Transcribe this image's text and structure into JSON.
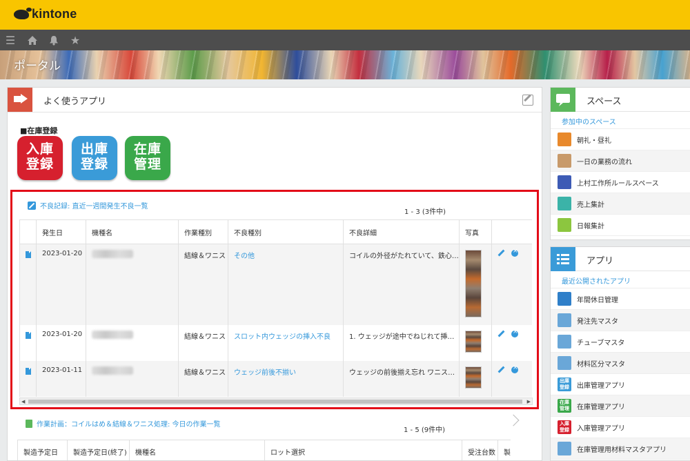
{
  "app": {
    "brand": "kintone"
  },
  "banner": {
    "title": "ポータル"
  },
  "main": {
    "title": "よく使うアプリ",
    "section_label": "■在庫登録",
    "tiles": [
      {
        "line1": "入庫",
        "line2": "登録",
        "color": "#d6202e"
      },
      {
        "line1": "出庫",
        "line2": "登録",
        "color": "#3a9bd8"
      },
      {
        "line1": "在庫",
        "line2": "管理",
        "color": "#3aa84a"
      }
    ]
  },
  "defect_list": {
    "title": "不良記録: 直近一週間発生不良一覧",
    "pager": "1 - 3 (3件中)",
    "columns": [
      "",
      "発生日",
      "機種名",
      "作業種別",
      "不良種別",
      "不良詳細",
      "写真",
      ""
    ],
    "rows": [
      {
        "date": "2023-01-20",
        "work": "結線＆ワニス",
        "defect": "その他",
        "detail": "コイルの外径がたれていて、鉄心…"
      },
      {
        "date": "2023-01-20",
        "work": "結線＆ワニス",
        "defect": "スロット内ウェッジの挿入不良",
        "detail": "1. ウェッジが途中でねじれて挿…"
      },
      {
        "date": "2023-01-11",
        "work": "結線＆ワニス",
        "defect": "ウェッジ前後不揃い",
        "detail": "ウェッジの前後揃え忘れ ワニス…"
      }
    ]
  },
  "plan_list": {
    "title": "作業計画：コイルはめ＆結線＆ワニス処理: 今日の作業一覧",
    "pager": "1 - 5 (9件中)",
    "columns": [
      "製造予定日",
      "製造予定日(終了)",
      "機種名",
      "ロット選択",
      "受注台数",
      "製"
    ]
  },
  "spaces": {
    "title": "スペース",
    "subtitle": "参加中のスペース",
    "items": [
      {
        "label": "朝礼・昼礼",
        "color": "#e8892c"
      },
      {
        "label": "一日の業務の流れ",
        "color": "#c89a6a"
      },
      {
        "label": "上村工作所ルールスペース",
        "color": "#3d5bb5"
      },
      {
        "label": "売上集計",
        "color": "#3bb3a8"
      },
      {
        "label": "日報集計",
        "color": "#8cc63f"
      }
    ]
  },
  "apps": {
    "title": "アプリ",
    "subtitle": "最近公開されたアプリ",
    "items": [
      {
        "label": "年間休日管理",
        "color": "#2f7fc9",
        "text": ""
      },
      {
        "label": "発注先マスタ",
        "color": "#6aa7d8",
        "text": ""
      },
      {
        "label": "チューブマスタ",
        "color": "#6aa7d8",
        "text": ""
      },
      {
        "label": "材料区分マスタ",
        "color": "#6aa7d8",
        "text": ""
      },
      {
        "label": "出庫管理アプリ",
        "color": "#3a9bd8",
        "text": "出庫\n登録"
      },
      {
        "label": "在庫管理アプリ",
        "color": "#3aa84a",
        "text": "在庫\n管理"
      },
      {
        "label": "入庫管理アプリ",
        "color": "#d6202e",
        "text": "入庫\n登録"
      },
      {
        "label": "在庫管理用材料マスタアプリ",
        "color": "#6aa7d8",
        "text": ""
      }
    ]
  }
}
